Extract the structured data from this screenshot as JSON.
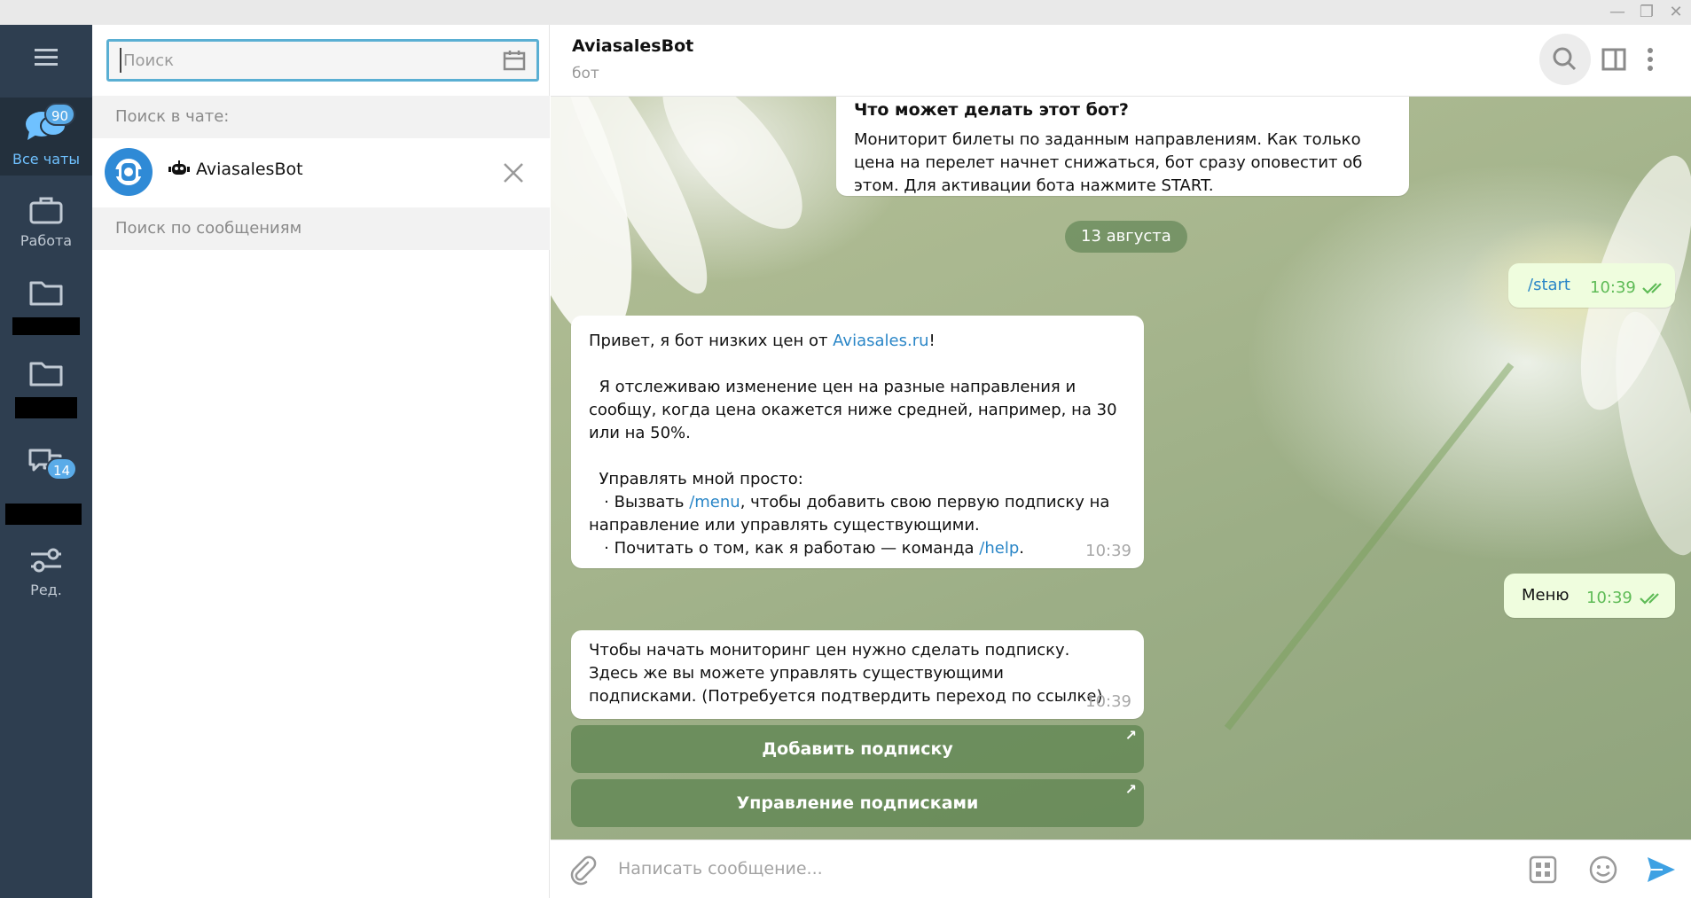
{
  "window": {
    "minimize_glyph": "—",
    "restore_glyph": "❐",
    "close_glyph": "✕"
  },
  "folders": [
    {
      "label": "Все чаты",
      "badge": "90",
      "icon": "chats-icon"
    },
    {
      "label": "Работа",
      "icon": "briefcase-icon"
    },
    {
      "label": "",
      "icon": "folder-icon"
    },
    {
      "label": "",
      "icon": "folder-icon"
    },
    {
      "label": "",
      "badge": "14",
      "icon": "chats-outline-icon"
    },
    {
      "label": "Ред.",
      "icon": "filter-sliders-icon"
    }
  ],
  "search": {
    "placeholder": "Поиск",
    "in_chat_header": "Поиск в чате:",
    "messages_header": "Поиск по сообщениям",
    "chat_name": "AviasalesBot"
  },
  "header": {
    "title": "AviasalesBot",
    "subtitle": "бот"
  },
  "messages": {
    "intro_title": "Что может делать этот бот?",
    "intro_text": "Мониторит билеты по заданным направлениям. Как только цена на перелет начнет снижаться, бот сразу оповестит об этом. Для активации бота нажмите  START.",
    "date": "13 августа",
    "out1": {
      "text": "/start",
      "time": "10:39"
    },
    "in1": {
      "p1_pre": "Привет, я бот низких цен от ",
      "p1_link": "Aviasales.ru",
      "p1_post": "!",
      "p2": "  Я отслеживаю изменение цен на разные направления и сообщу, когда цена окажется ниже средней, например, на 30 или на 50%.",
      "p3": "  Управлять мной просто:",
      "b1_pre": "   · Вызвать ",
      "b1_link": "/menu",
      "b1_post": ", чтобы добавить свою первую подписку на направление или управлять существующими.",
      "b2_pre": "   · Почитать о том, как я работаю — команда ",
      "b2_link": "/help",
      "b2_post": ".",
      "time": "10:39"
    },
    "out2": {
      "text": "Меню",
      "time": "10:39"
    },
    "in2": {
      "text": "Чтобы начать мониторинг цен нужно сделать подписку. Здесь же вы можете управлять существующими подписками. (Потребуется подтвердить переход по ссылке)",
      "time": "10:39"
    },
    "buttons": [
      "Добавить подписку",
      "Управление подписками"
    ]
  },
  "composer": {
    "placeholder": "Написать сообщение..."
  },
  "colors": {
    "sidebar": "#2e3e50",
    "accent": "#5aabe8",
    "outgoing": "#effdde",
    "link": "#2a86c7"
  }
}
